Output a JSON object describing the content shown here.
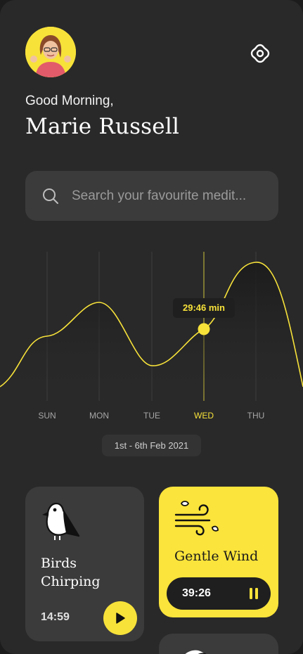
{
  "header": {
    "greeting": "Good Morning,",
    "user_name": "Marie Russell"
  },
  "search": {
    "placeholder": "Search your favourite medit..."
  },
  "colors": {
    "accent": "#f7e23a",
    "background": "#292929",
    "card": "#3b3b3b"
  },
  "icons": {
    "settings": "flower-gear-icon",
    "search": "search-icon",
    "play": "play-icon",
    "pause": "pause-icon"
  },
  "chart_data": {
    "type": "area",
    "categories": [
      "SUN",
      "MON",
      "TUE",
      "WED",
      "THU"
    ],
    "highlight_category": "WED",
    "highlight_label": "29:46 min",
    "date_range": "1st - 6th Feb 2021",
    "grid": true,
    "legend": "none"
  },
  "cards": [
    {
      "title": "Birds Chirping",
      "duration": "14:59",
      "state": "paused"
    },
    {
      "title": "Gentle Wind",
      "duration": "39:26",
      "state": "playing"
    }
  ]
}
